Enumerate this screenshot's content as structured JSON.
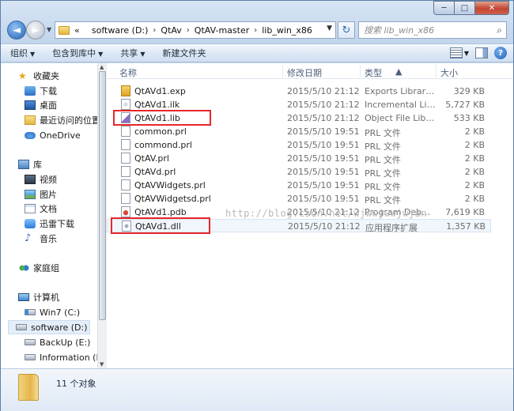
{
  "window": {
    "caption": {
      "minimize": "─",
      "maximize": "□",
      "close": "✕"
    }
  },
  "address": {
    "prefix": "«",
    "crumbs": [
      "software (D:)",
      "QtAv",
      "QtAV-master",
      "lib_win_x86"
    ],
    "search_placeholder": "搜索 lib_win_x86"
  },
  "toolbar": {
    "organize": "组织",
    "include": "包含到库中",
    "share": "共享",
    "new_folder": "新建文件夹"
  },
  "sidebar": {
    "favorites": {
      "label": "收藏夹",
      "items": [
        "下载",
        "桌面",
        "最近访问的位置",
        "OneDrive"
      ]
    },
    "libraries": {
      "label": "库",
      "items": [
        "视频",
        "图片",
        "文档",
        "迅雷下载",
        "音乐"
      ]
    },
    "homegroup": "家庭组",
    "computer": {
      "label": "计算机",
      "items": [
        "Win7 (C:)",
        "software (D:)",
        "BackUp (E:)",
        "Information (F:)"
      ]
    }
  },
  "columns": {
    "name": "名称",
    "date": "修改日期",
    "type": "类型",
    "size": "大小"
  },
  "files": [
    {
      "name": "QtAVd1.exp",
      "date": "2015/5/10 21:12",
      "type": "Exports Library ...",
      "size": "329 KB",
      "icon": "exp-icon"
    },
    {
      "name": "QtAVd1.ilk",
      "date": "2015/5/10 21:12",
      "type": "Incremental Link...",
      "size": "5,727 KB",
      "icon": "ilk-icon"
    },
    {
      "name": "QtAVd1.lib",
      "date": "2015/5/10 21:12",
      "type": "Object File Library",
      "size": "533 KB",
      "icon": "lib-icon"
    },
    {
      "name": "common.prl",
      "date": "2015/5/10 19:51",
      "type": "PRL 文件",
      "size": "2 KB",
      "icon": "file-icon"
    },
    {
      "name": "commond.prl",
      "date": "2015/5/10 19:51",
      "type": "PRL 文件",
      "size": "2 KB",
      "icon": "file-icon"
    },
    {
      "name": "QtAV.prl",
      "date": "2015/5/10 19:51",
      "type": "PRL 文件",
      "size": "2 KB",
      "icon": "file-icon"
    },
    {
      "name": "QtAVd.prl",
      "date": "2015/5/10 19:51",
      "type": "PRL 文件",
      "size": "2 KB",
      "icon": "file-icon"
    },
    {
      "name": "QtAVWidgets.prl",
      "date": "2015/5/10 19:51",
      "type": "PRL 文件",
      "size": "2 KB",
      "icon": "file-icon"
    },
    {
      "name": "QtAVWidgetsd.prl",
      "date": "2015/5/10 19:51",
      "type": "PRL 文件",
      "size": "2 KB",
      "icon": "file-icon"
    },
    {
      "name": "QtAVd1.pdb",
      "date": "2015/5/10 21:12",
      "type": "Program Debug...",
      "size": "7,619 KB",
      "icon": "pdb-icon"
    },
    {
      "name": "QtAVd1.dll",
      "date": "2015/5/10 21:12",
      "type": "应用程序扩展",
      "size": "1,357 KB",
      "icon": "dll-icon"
    }
  ],
  "watermark": "http://blog.csdn.net/wjwwjwwjwjan",
  "status": {
    "count": "11 个对象"
  },
  "colors": {
    "highlight": "#e8262a",
    "selection": "#e5eef8"
  }
}
